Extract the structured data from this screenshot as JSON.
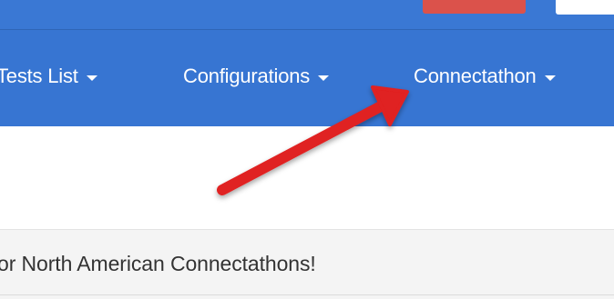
{
  "nav": {
    "items": [
      {
        "label": "Tests List"
      },
      {
        "label": "Configurations"
      },
      {
        "label": "Connectathon"
      }
    ]
  },
  "banner": {
    "text": "or North American Connectathons!"
  },
  "colors": {
    "navbar": "#3775d2",
    "topbar": "#3a78d4",
    "top_button": "#db524b",
    "arrow": "#e02020",
    "banner_bg": "#f4f4f4",
    "text": "#333333"
  },
  "icons": {
    "caret": "chevron-down-icon",
    "annotation": "red-arrow-icon"
  }
}
